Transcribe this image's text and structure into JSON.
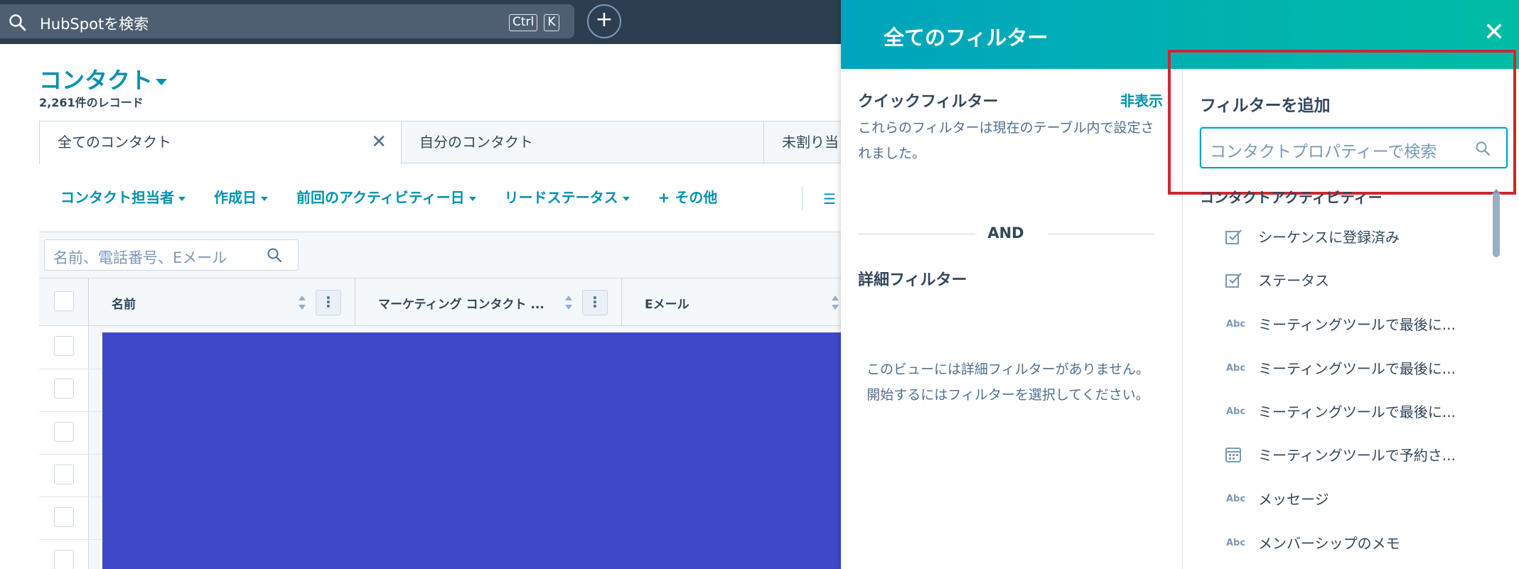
{
  "topnav": {
    "search_placeholder": "HubSpotを検索",
    "shortcut_ctrl": "Ctrl",
    "shortcut_key": "K",
    "add_button": "+"
  },
  "page": {
    "title": "コンタクト",
    "record_count": "2,261件のレコード"
  },
  "views": {
    "tabs": [
      {
        "label": "全てのコンタクト",
        "active": true
      },
      {
        "label": "自分のコンタクト",
        "active": false
      },
      {
        "label": "未割り当",
        "active": false
      }
    ],
    "close": "✕"
  },
  "filters": {
    "items": [
      {
        "label": "コンタクト担当者"
      },
      {
        "label": "作成日"
      },
      {
        "label": "前回のアクティビティー日"
      },
      {
        "label": "リードステータス"
      },
      {
        "label": "+ その他"
      }
    ]
  },
  "table": {
    "search_placeholder": "名前、電話番号、Eメール",
    "columns": [
      {
        "label": "名前"
      },
      {
        "label": "マーケティング コンタクト ..."
      },
      {
        "label": "Eメール"
      }
    ],
    "col_menu": "⋮"
  },
  "panel": {
    "title": "全てのフィルター",
    "close": "✕",
    "quick": {
      "title": "クイックフィルター",
      "hide_link": "非表示",
      "description": "これらのフィルターは現在のテーブル内で設定されました。"
    },
    "and_label": "AND",
    "detail": {
      "title": "詳細フィルター",
      "empty": "このビューには詳細フィルターがありません。開始するにはフィルターを選択してください。"
    },
    "add": {
      "title": "フィルターを追加",
      "search_placeholder": "コンタクトプロパティーで検索",
      "group_header": "コンタクトアクティビティー",
      "properties": [
        {
          "icon": "checkbox-icon",
          "label": "シーケンスに登録済み"
        },
        {
          "icon": "checkbox-icon",
          "label": "ステータス"
        },
        {
          "icon": "text-icon",
          "label": "ミーティングツールで最後に..."
        },
        {
          "icon": "text-icon",
          "label": "ミーティングツールで最後に..."
        },
        {
          "icon": "text-icon",
          "label": "ミーティングツールで最後に..."
        },
        {
          "icon": "calendar-icon",
          "label": "ミーティングツールで予約さ..."
        },
        {
          "icon": "text-icon",
          "label": "メッセージ"
        },
        {
          "icon": "text-icon",
          "label": "メンバーシップのメモ"
        }
      ],
      "abc": "Abc"
    }
  },
  "colors": {
    "nav_bg": "#2d3e50",
    "accent": "#0091ae",
    "header_gradient_start": "#00a4bd",
    "header_gradient_end": "#00bda5",
    "highlight_box": "#d0252f",
    "blue_block": "#3f48c8"
  }
}
